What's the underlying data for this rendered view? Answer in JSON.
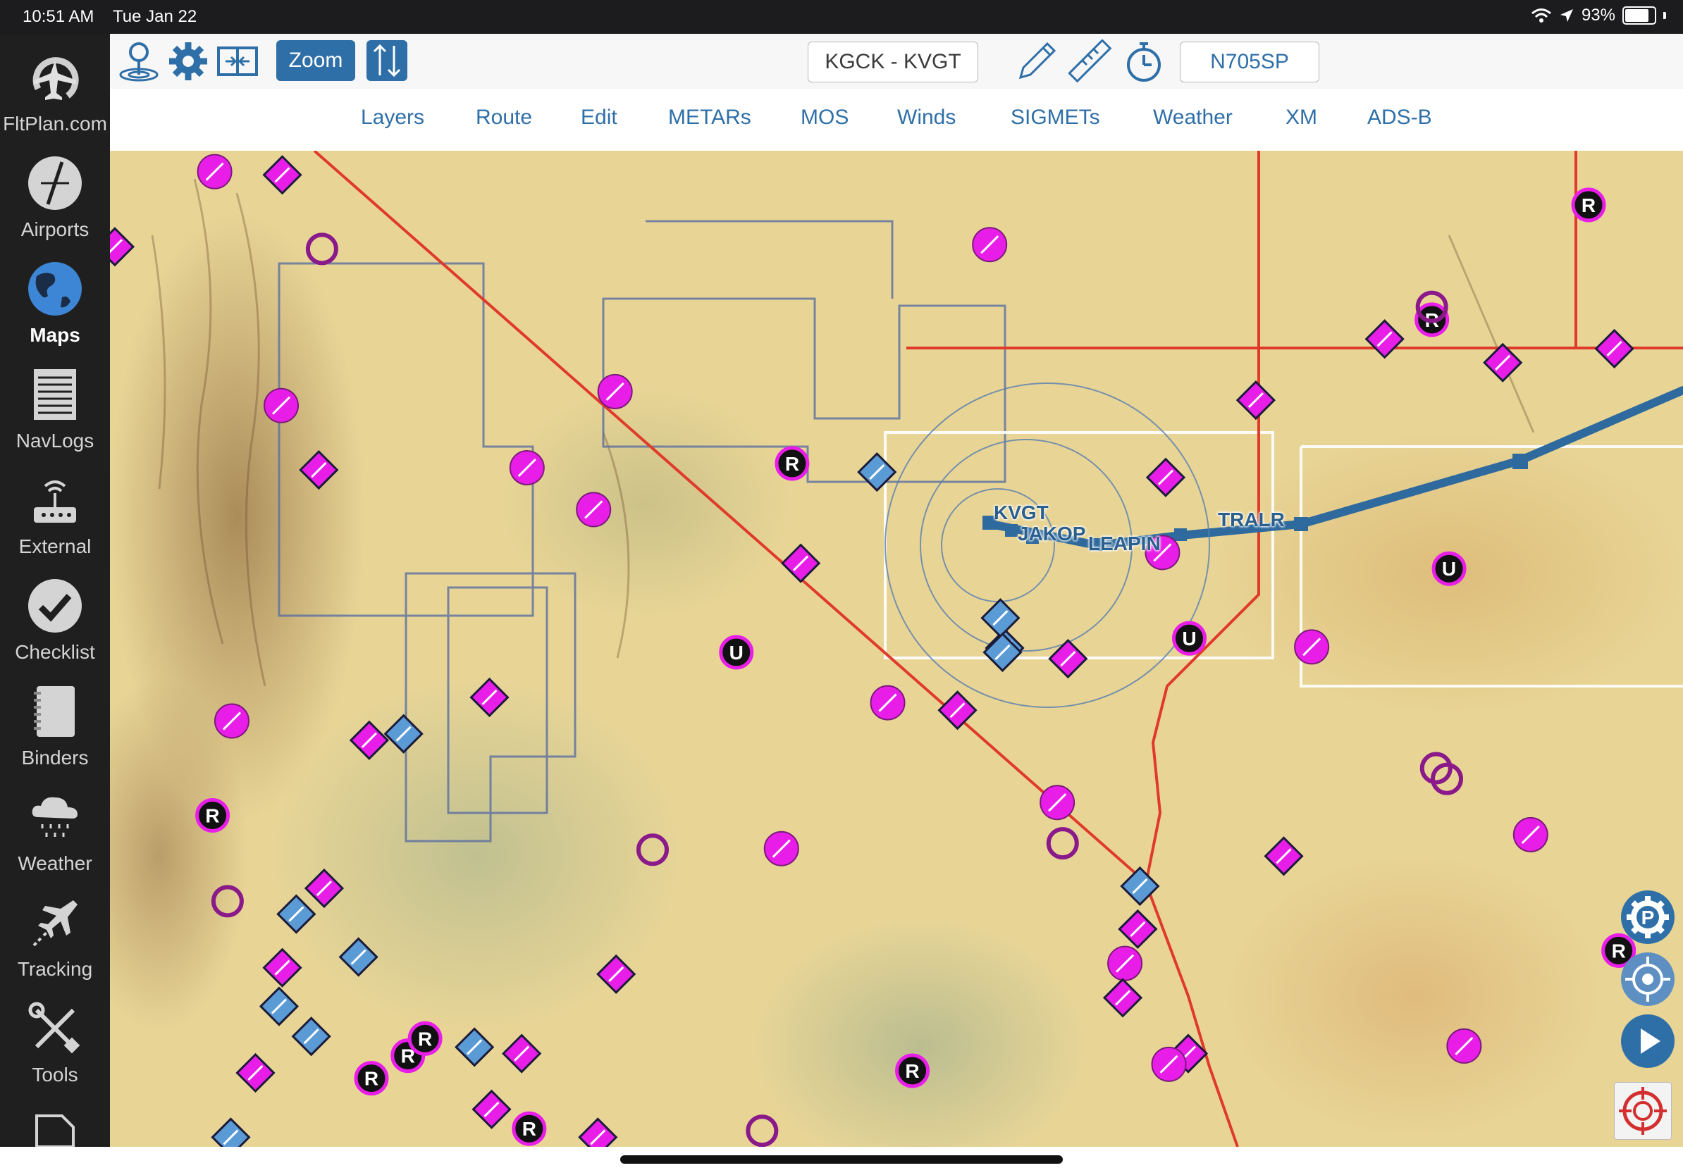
{
  "status_bar": {
    "time": "10:51 AM",
    "date": "Tue Jan 22",
    "battery_text": "93%",
    "battery_level": 0.93
  },
  "sidebar": {
    "items": [
      {
        "label": "FltPlan.com",
        "icon": "fltplan-logo-icon",
        "active": false
      },
      {
        "label": "Airports",
        "icon": "compass-icon",
        "active": false
      },
      {
        "label": "Maps",
        "icon": "globe-icon",
        "active": true
      },
      {
        "label": "NavLogs",
        "icon": "document-lines-icon",
        "active": false
      },
      {
        "label": "External",
        "icon": "wireless-device-icon",
        "active": false
      },
      {
        "label": "Checklist",
        "icon": "checkmark-circle-icon",
        "active": false
      },
      {
        "label": "Binders",
        "icon": "binder-icon",
        "active": false
      },
      {
        "label": "Weather",
        "icon": "rain-cloud-icon",
        "active": false
      },
      {
        "label": "Tracking",
        "icon": "airplane-track-icon",
        "active": false
      },
      {
        "label": "Tools",
        "icon": "wrench-screwdriver-icon",
        "active": false
      }
    ]
  },
  "toolbar": {
    "zoom_label": "Zoom",
    "route": "KGCK - KVGT",
    "aircraft": "N705SP"
  },
  "menu": [
    "Layers",
    "Route",
    "Edit",
    "METARs",
    "MOS",
    "Winds",
    "SIGMETs",
    "Weather",
    "XM",
    "ADS-B"
  ],
  "map": {
    "waypoints": [
      "KVGT",
      "JAKOP",
      "LEAPIN",
      "TRALR"
    ],
    "route_color": "#2e6a9e",
    "airport_marker_color": "#e81ee8",
    "public_airport_color": "#5b9bd5",
    "airspace_line_color": "#e03a2a"
  },
  "colors": {
    "accent": "#2f6fa8",
    "sidebar_bg": "#1f1f1f",
    "status_bg": "#1c1c1e"
  }
}
